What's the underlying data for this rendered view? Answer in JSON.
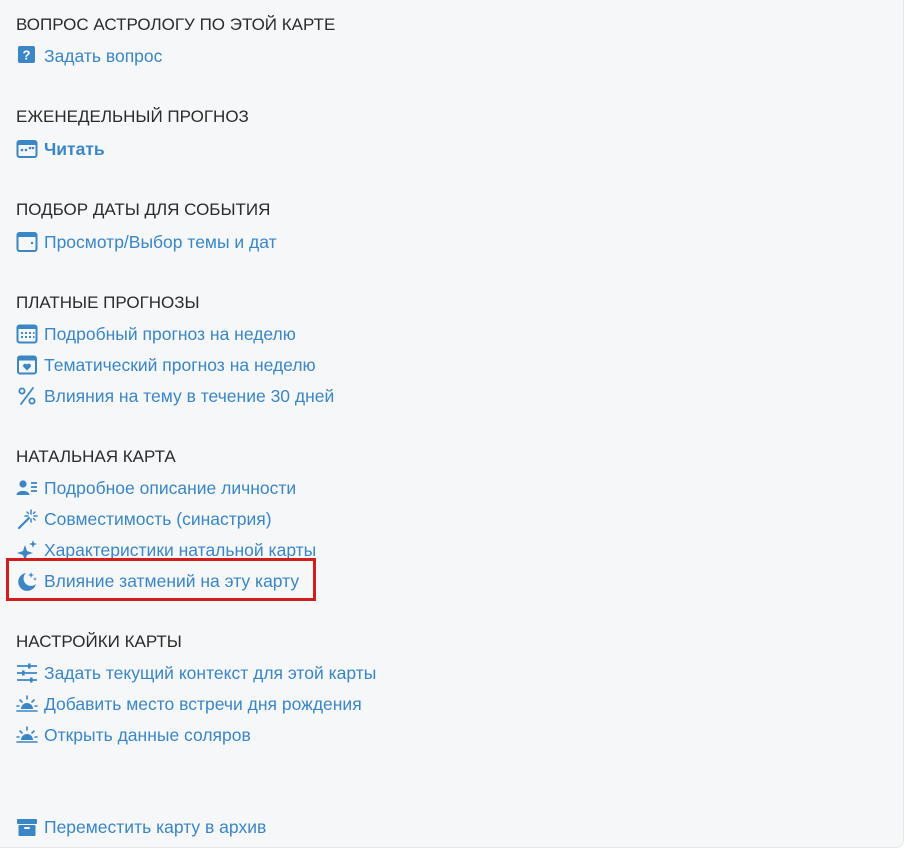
{
  "sections": {
    "question": {
      "title": "ВОПРОС АСТРОЛОГУ ПО ЭТОЙ КАРТЕ",
      "items": [
        {
          "label": "Задать вопрос",
          "icon": "question-icon"
        }
      ]
    },
    "weekly": {
      "title": "ЕЖЕНЕДЕЛЬНЫЙ ПРОГНОЗ",
      "items": [
        {
          "label": "Читать",
          "icon": "calendar-dots-icon"
        }
      ]
    },
    "date_pick": {
      "title": "ПОДБОР ДАТЫ ДЛЯ СОБЫТИЯ",
      "items": [
        {
          "label": "Просмотр/Выбор темы и дат",
          "icon": "calendar-blank-icon"
        }
      ]
    },
    "paid": {
      "title": "ПЛАТНЫЕ ПРОГНОЗЫ",
      "items": [
        {
          "label": "Подробный прогноз на неделю",
          "icon": "calendar-grid-icon"
        },
        {
          "label": "Тематический прогноз на неделю",
          "icon": "calendar-heart-icon"
        },
        {
          "label": "Влияния на тему в течение 30 дней",
          "icon": "percent-icon"
        }
      ]
    },
    "natal": {
      "title": "НАТАЛЬНАЯ КАРТА",
      "items": [
        {
          "label": "Подробное описание личности",
          "icon": "user-list-icon"
        },
        {
          "label": "Совместимость (синастрия)",
          "icon": "magic-wand-icon"
        },
        {
          "label": "Характеристики натальной карты",
          "icon": "sparkles-icon"
        },
        {
          "label": "Влияние затмений на эту карту",
          "icon": "moon-stars-icon"
        }
      ]
    },
    "settings": {
      "title": "НАСТРОЙКИ КАРТЫ",
      "items": [
        {
          "label": "Задать текущий контекст для этой карты",
          "icon": "sliders-icon"
        },
        {
          "label": "Добавить место встречи дня рождения",
          "icon": "sunrise-icon"
        },
        {
          "label": "Открыть данные соляров",
          "icon": "sunrise-icon"
        }
      ]
    },
    "archive": {
      "items": [
        {
          "label": "Переместить карту в архив",
          "icon": "archive-icon"
        }
      ]
    }
  },
  "colors": {
    "link": "#3b86c4",
    "title": "#2b2b2b",
    "background": "#f6f7f9",
    "highlight": "#d31c1c"
  }
}
